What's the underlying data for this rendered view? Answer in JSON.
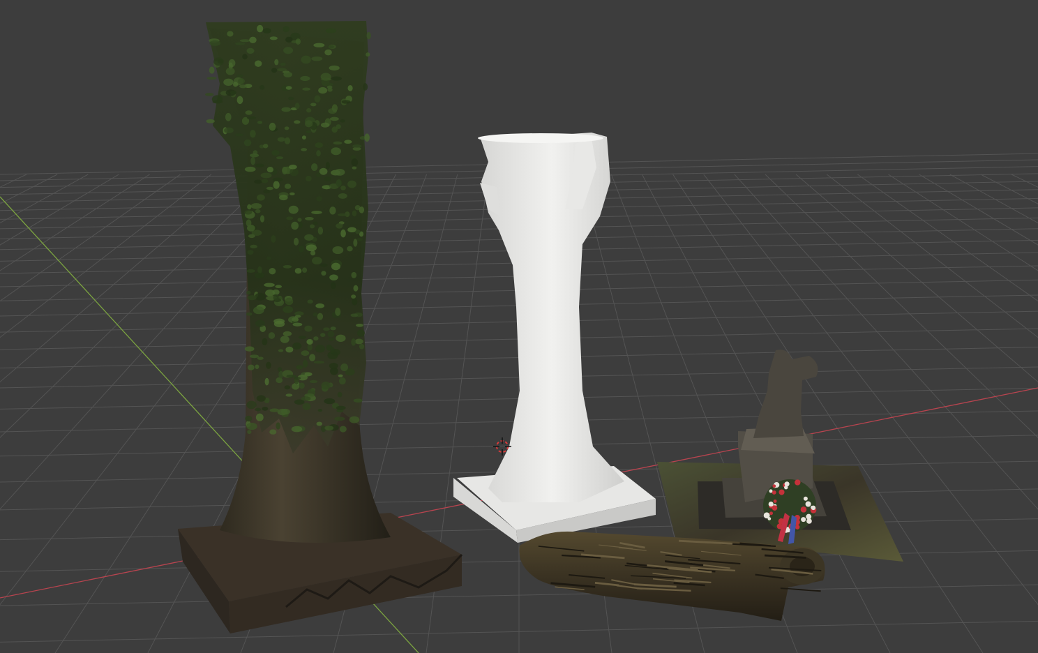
{
  "viewport": {
    "background": "#3d3d3d",
    "grid_color": "#545454",
    "x_axis_color": "#b8444f",
    "y_axis_color": "#7ba340",
    "cursor_color": "#d83a3a"
  },
  "objects": [
    {
      "name": "ivy-covered-tree-trunk",
      "description_icon": "scan-tree-icon",
      "color": "#3b3326"
    },
    {
      "name": "white-tree-stump-mesh",
      "description_icon": "mesh-icon",
      "color": "#e4e4e2"
    },
    {
      "name": "kneeling-soldier-statue",
      "description_icon": "statue-icon",
      "color": "#4f4a40"
    },
    {
      "name": "fallen-log",
      "description_icon": "log-icon",
      "color": "#3e3626"
    }
  ]
}
